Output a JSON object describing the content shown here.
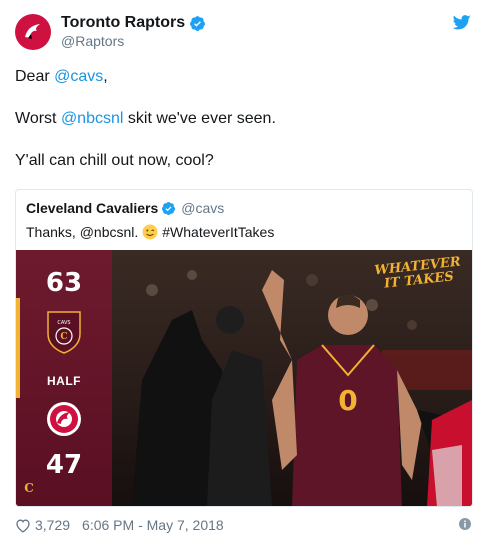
{
  "account": {
    "display_name": "Toronto Raptors",
    "handle": "@Raptors"
  },
  "tweet": {
    "line1_prefix": "Dear ",
    "line1_mention": "@cavs",
    "line1_suffix": ",",
    "line2_prefix": "Worst ",
    "line2_mention": "@nbcsnl",
    "line2_suffix": " skit we've ever seen.",
    "line3": "Y'all can chill out now, cool?"
  },
  "quoted": {
    "display_name": "Cleveland Cavaliers",
    "handle": "@cavs",
    "text_before": "Thanks, @nbcsnl.",
    "text_after": "#WhateverItTakes",
    "media": {
      "home_score": "63",
      "period": "HALF",
      "away_score": "47",
      "home_team_logo_text": "CLEVELAND CAVALIERS",
      "away_team_logo_text": "TORONTO RAPTORS",
      "tagline_line1": "WHATEVER",
      "tagline_line2": "IT TAKES",
      "jersey_number": "0"
    }
  },
  "footer": {
    "likes": "3,729",
    "timestamp": "6:06 PM - May 7, 2018"
  },
  "colors": {
    "link": "#1b95e0",
    "secondary_text": "#657786",
    "raptors_red": "#ce1141",
    "cavs_wine": "#6e1a2e",
    "cavs_gold": "#f2b233"
  },
  "icons": {
    "verified": "verified-badge-icon",
    "brand": "twitter-bird-icon",
    "like": "heart-icon",
    "info": "info-icon"
  }
}
